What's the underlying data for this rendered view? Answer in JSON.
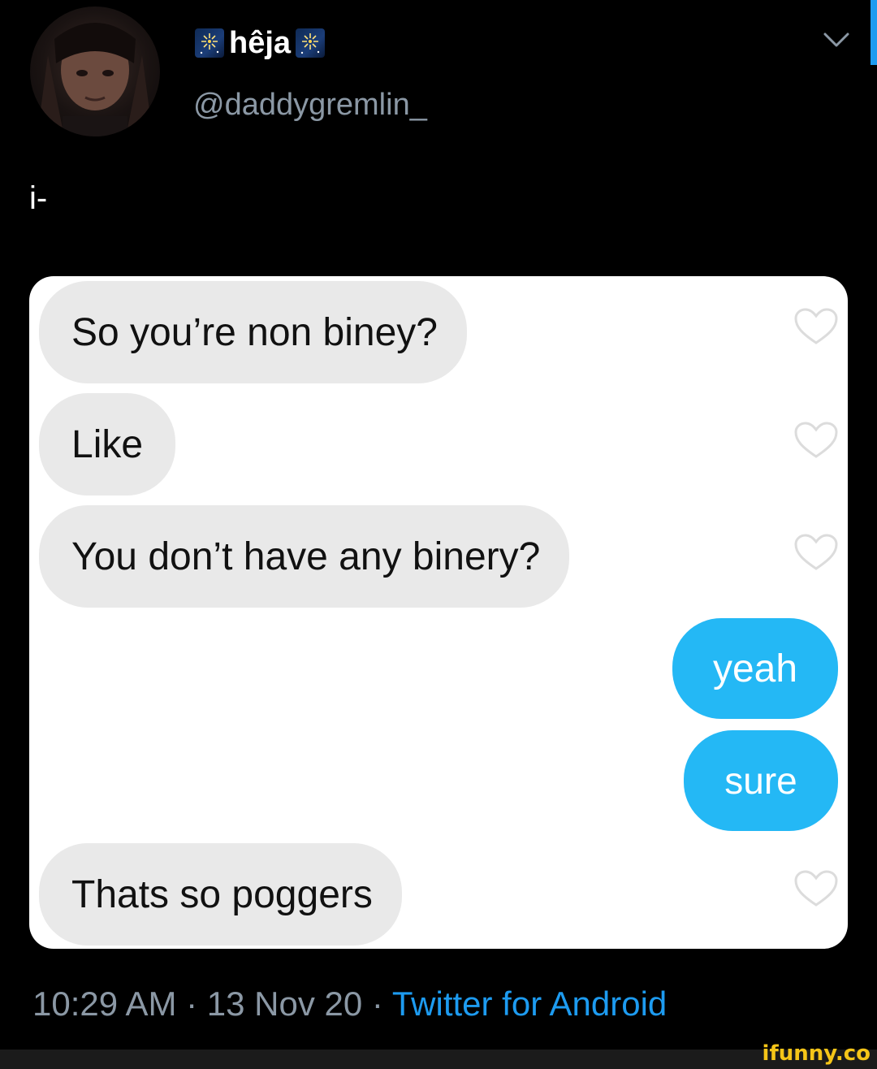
{
  "tweet": {
    "display_name": "hêja",
    "name_emoji": "fireworks-emoji",
    "handle": "@daddygremlin_",
    "text": "i-",
    "timestamp": "10:29 AM · 13 Nov 20 · ",
    "source": "Twitter for Android",
    "colors": {
      "background": "#000000",
      "handle_gray": "#8b98a5",
      "link_blue": "#1d9bf0"
    }
  },
  "chat": {
    "messages": [
      {
        "text": "So you’re non biney?",
        "side": "received"
      },
      {
        "text": "Like",
        "side": "received"
      },
      {
        "text": "You don’t have any binery?",
        "side": "received"
      },
      {
        "text": "yeah",
        "side": "sent"
      },
      {
        "text": "sure",
        "side": "sent"
      },
      {
        "text": "Thats so poggers",
        "side": "received"
      }
    ],
    "colors": {
      "received_bubble": "#e9e9e9",
      "sent_bubble": "#24b8f5"
    },
    "like_icon": "heart-outline-icon"
  },
  "watermark": {
    "text": "ifunny.co"
  }
}
